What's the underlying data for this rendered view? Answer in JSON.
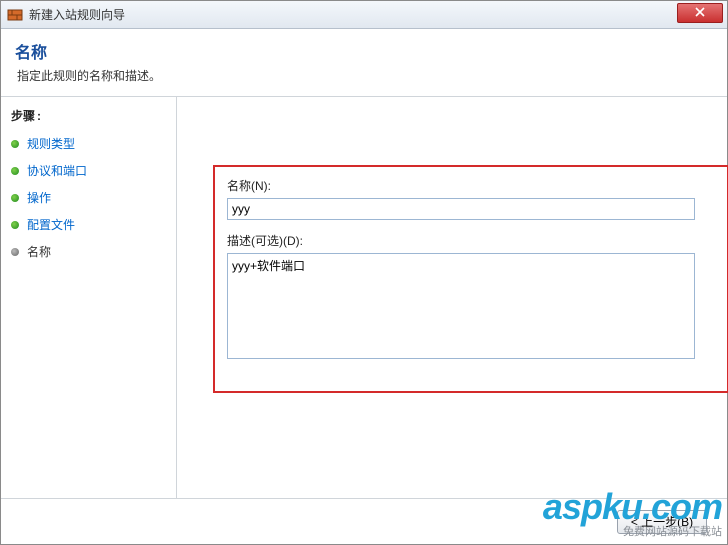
{
  "titlebar": {
    "title": "新建入站规则向导"
  },
  "header": {
    "title": "名称",
    "subtitle": "指定此规则的名称和描述。"
  },
  "sidebar": {
    "steps_label": "步骤",
    "colon": ":",
    "items": [
      {
        "label": "规则类型",
        "current": false
      },
      {
        "label": "协议和端口",
        "current": false
      },
      {
        "label": "操作",
        "current": false
      },
      {
        "label": "配置文件",
        "current": false
      },
      {
        "label": "名称",
        "current": true
      }
    ]
  },
  "form": {
    "name_label": "名称(N):",
    "name_value": "yyy",
    "desc_label": "描述(可选)(D):",
    "desc_value": "yyy+软件端口"
  },
  "footer": {
    "back_label": "< 上一步(B)"
  },
  "watermark": {
    "brand": "aspku",
    "suffix": ".com",
    "tagline": "免费网站源码下载站"
  }
}
